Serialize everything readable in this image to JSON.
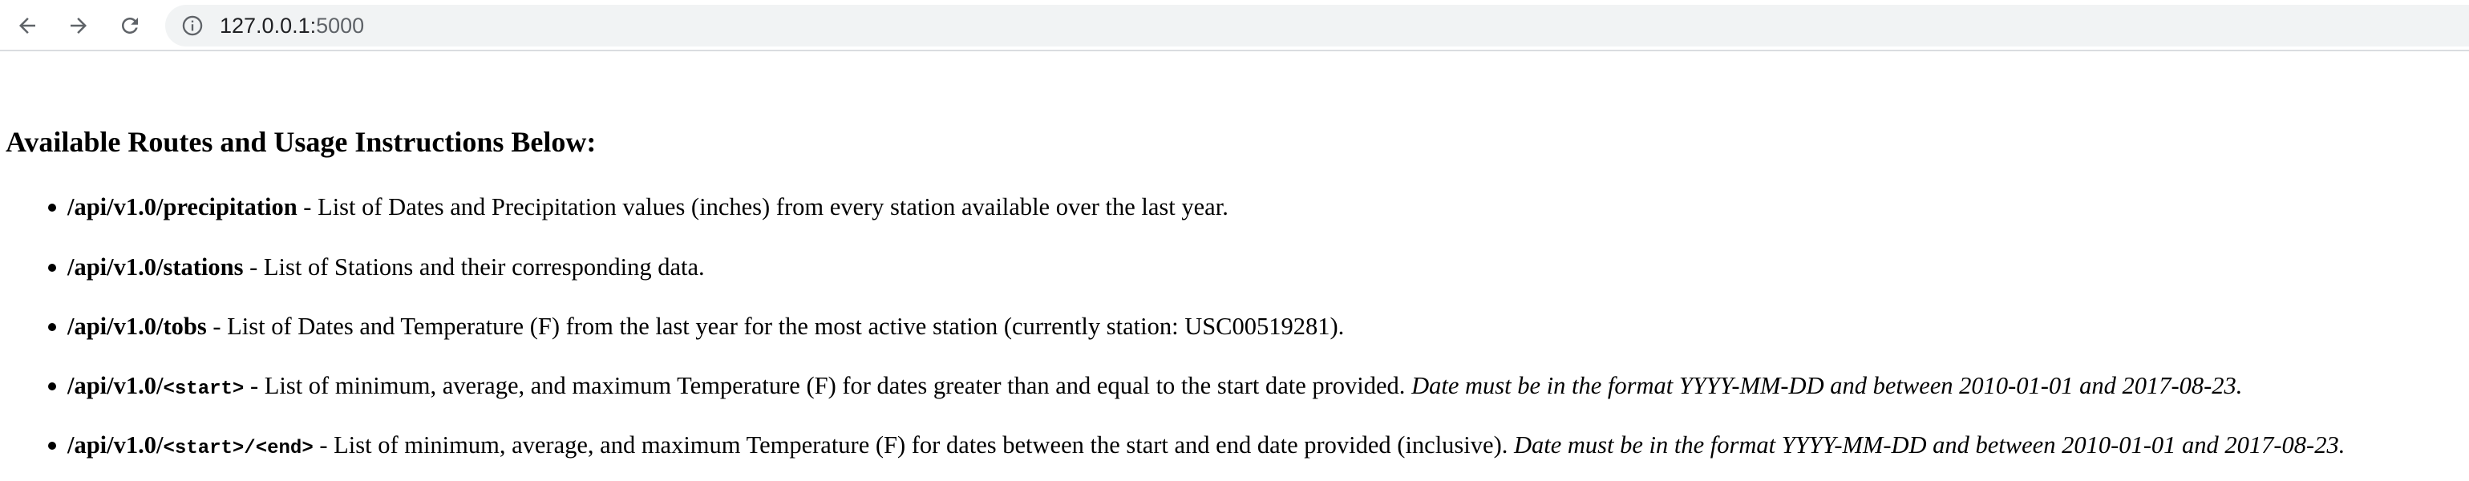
{
  "browser": {
    "url_host": "127.0.0.1:",
    "url_port": "5000"
  },
  "page": {
    "heading": "Available Routes and Usage Instructions Below:",
    "routes": [
      {
        "path": "/api/v1.0/precipitation",
        "description": " - List of Dates and Precipitation values (inches) from every station available over the last year."
      },
      {
        "path": "/api/v1.0/stations",
        "description": " - List of Stations and their corresponding data."
      },
      {
        "path": "/api/v1.0/tobs",
        "description": " - List of Dates and Temperature (F) from the last year for the most active station (currently station: USC00519281)."
      },
      {
        "path_prefix": "/api/v1.0/",
        "path_code": "<start>",
        "description": " - List of minimum, average, and maximum Temperature (F) for dates greater than and equal to the start date provided. ",
        "note": "Date must be in the format YYYY-MM-DD and between 2010-01-01 and 2017-08-23."
      },
      {
        "path_prefix": "/api/v1.0/",
        "path_code": "<start>/<end>",
        "description": " - List of minimum, average, and maximum Temperature (F) for dates between the start and end date provided (inclusive). ",
        "note": "Date must be in the format YYYY-MM-DD and between 2010-01-01 and 2017-08-23."
      }
    ]
  }
}
